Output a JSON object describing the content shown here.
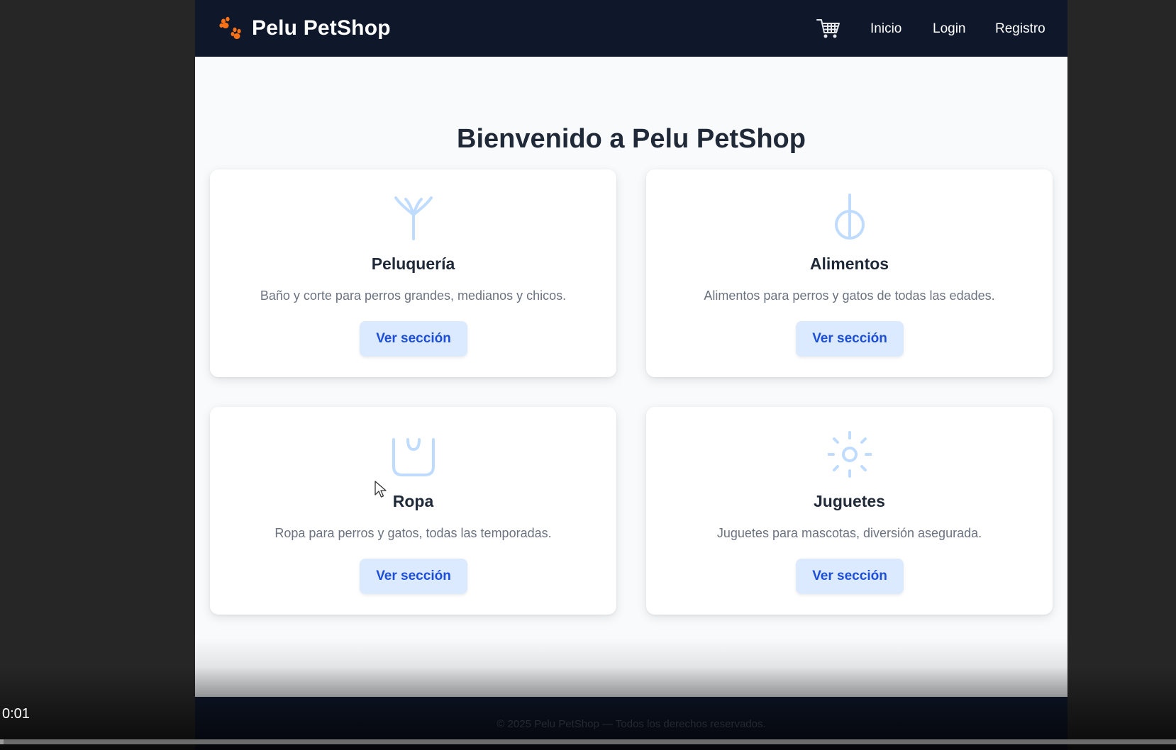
{
  "navbar": {
    "brand": "Pelu PetShop",
    "brand_icon": "paw-icon",
    "cart_icon": "cart-icon",
    "links": [
      "Inicio",
      "Login",
      "Registro"
    ]
  },
  "main": {
    "title": "Bienvenido a Pelu PetShop",
    "cards": [
      {
        "icon": "scissors-icon",
        "title": "Peluquería",
        "description": "Baño y corte para perros grandes, medianos y chicos.",
        "button": "Ver sección"
      },
      {
        "icon": "food-icon",
        "title": "Alimentos",
        "description": "Alimentos para perros y gatos de todas las edades.",
        "button": "Ver sección"
      },
      {
        "icon": "shirt-icon",
        "title": "Ropa",
        "description": "Ropa para perros y gatos, todas las temporadas.",
        "button": "Ver sección"
      },
      {
        "icon": "sun-icon",
        "title": "Juguetes",
        "description": "Juguetes para mascotas, diversión asegurada.",
        "button": "Ver sección"
      }
    ]
  },
  "footer": {
    "text": "© 2025 Pelu PetShop — Todos los derechos reservados."
  },
  "video": {
    "timestamp": "0:01",
    "progress": 0.003
  },
  "colors": {
    "navbar_bg": "#0f172a",
    "icon_stroke": "#bfdbfe",
    "button_bg": "#dbeafe",
    "button_text": "#1d4ed8",
    "paw": "#f97316"
  }
}
